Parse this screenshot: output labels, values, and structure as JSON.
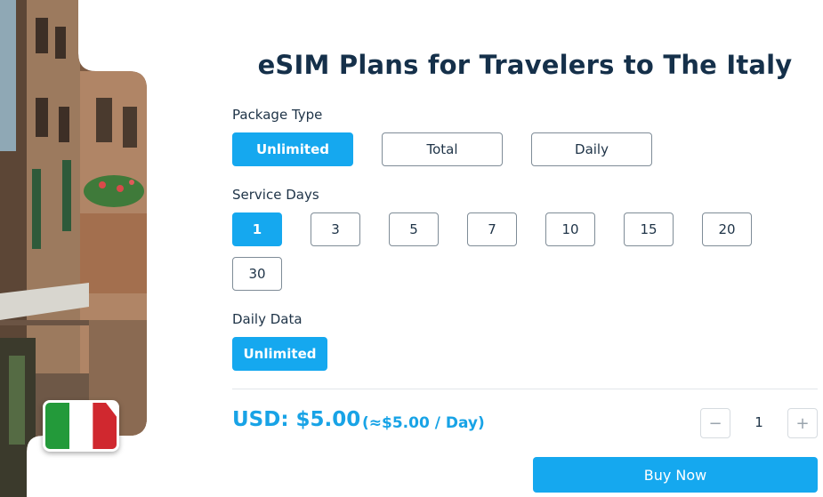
{
  "title": "eSIM Plans for Travelers to The Italy",
  "package_type": {
    "label": "Package Type",
    "options": [
      "Unlimited",
      "Total",
      "Daily"
    ],
    "selected": "Unlimited"
  },
  "service_days": {
    "label": "Service Days",
    "options": [
      "1",
      "3",
      "5",
      "7",
      "10",
      "15",
      "20",
      "30"
    ],
    "selected": "1"
  },
  "daily_data": {
    "label": "Daily Data",
    "options": [
      "Unlimited"
    ],
    "selected": "Unlimited"
  },
  "price": {
    "total": "USD: $5.00",
    "per_day": "(≈$5.00 / Day)"
  },
  "quantity": {
    "minus": "−",
    "value": "1",
    "plus": "+"
  },
  "buy_label": "Buy Now",
  "colors": {
    "accent": "#15a8ef",
    "title": "#15304a"
  },
  "hero": {
    "flag_icon": "italy-flag-icon"
  }
}
